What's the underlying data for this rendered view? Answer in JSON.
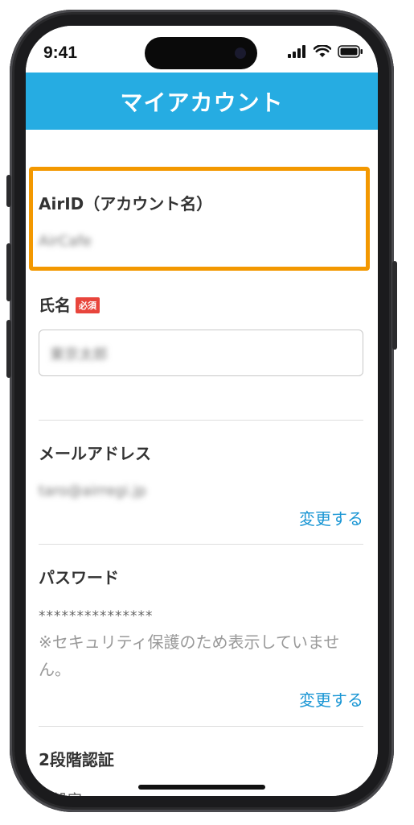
{
  "status_bar": {
    "time": "9:41"
  },
  "header": {
    "title": "マイアカウント"
  },
  "airid": {
    "label": "AirID（アカウント名）",
    "value": "AirCafe"
  },
  "name": {
    "label": "氏名",
    "required_badge": "必須",
    "value": "東京太郎"
  },
  "email": {
    "label": "メールアドレス",
    "value": "taro@airregi.jp",
    "change_label": "変更する"
  },
  "password": {
    "label": "パスワード",
    "masked": "***************",
    "note": "※セキュリティ保護のため表示していません。",
    "change_label": "変更する"
  },
  "two_factor": {
    "label": "2段階認証",
    "status": "未設定"
  },
  "colors": {
    "header_bg": "#26ace2",
    "link": "#1a96d4",
    "highlight": "#f39800",
    "required": "#e8453c"
  },
  "icons": [
    "cellular-signal-icon",
    "wifi-icon",
    "battery-icon"
  ]
}
